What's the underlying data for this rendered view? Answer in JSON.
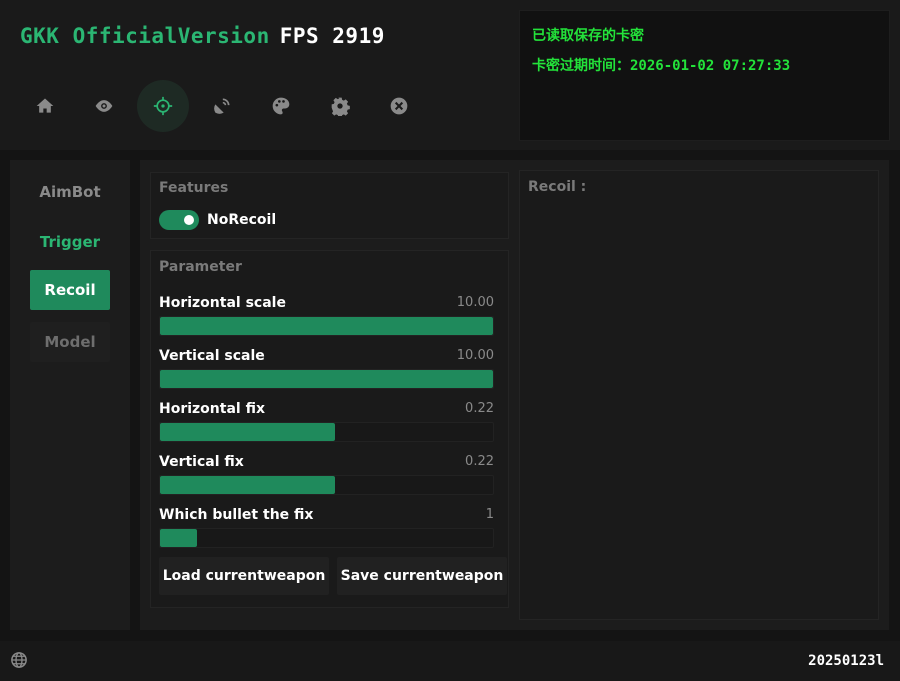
{
  "header": {
    "app_title": "GKK OfficialVersion",
    "fps_label": "FPS 2919"
  },
  "nav_icons": [
    "home-icon",
    "eye-icon",
    "crosshair-icon",
    "satellite-icon",
    "palette-icon",
    "gear-icon",
    "close-circle-icon"
  ],
  "nav_active": "crosshair-icon",
  "info": {
    "line1": "已读取保存的卡密",
    "line2": "卡密过期时间：2026-01-02 07:27:33"
  },
  "sidebar": {
    "items": [
      {
        "label": "AimBot"
      },
      {
        "label": "Trigger"
      },
      {
        "label": "Recoil"
      },
      {
        "label": "Model"
      }
    ],
    "active": "Recoil"
  },
  "features": {
    "title": "Features",
    "norecoil_label": "NoRecoil",
    "norecoil_on": true
  },
  "parameter": {
    "title": "Parameter",
    "params": [
      {
        "label": "Horizontal scale",
        "value": "10.00",
        "fill": 1.0
      },
      {
        "label": "Vertical scale",
        "value": "10.00",
        "fill": 1.0
      },
      {
        "label": "Horizontal fix",
        "value": "0.22",
        "fill": 0.525
      },
      {
        "label": "Vertical fix",
        "value": "0.22",
        "fill": 0.525
      },
      {
        "label": "Which bullet the fix",
        "value": "1",
        "fill": 0.11
      }
    ],
    "load_button": "Load currentweapon",
    "save_button": "Save currentweapon"
  },
  "recoil_panel": {
    "title": "Recoil :"
  },
  "footer": {
    "code": "20250123l"
  },
  "colors": {
    "accent": "#1f8a5c",
    "brand_green": "#2bb673",
    "info_green": "#23e23a",
    "background": "#141414"
  }
}
